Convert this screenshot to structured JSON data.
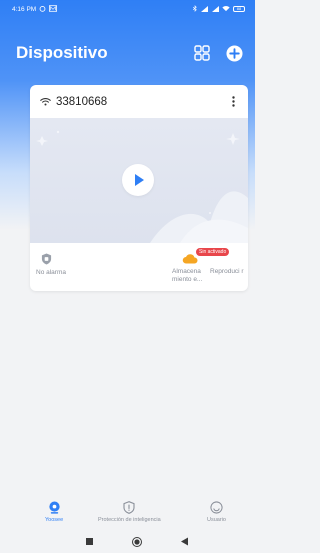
{
  "status_bar": {
    "time": "4:16 PM",
    "battery": "88"
  },
  "header": {
    "title": "Dispositivo"
  },
  "device_card": {
    "name": "33810668",
    "actions": [
      {
        "label": "No alarma"
      },
      {
        "label": "Almacena miento e...",
        "badge": "Sin activado"
      },
      {
        "label": "Reproduci r"
      }
    ]
  },
  "bottom_nav": {
    "items": [
      {
        "label": "Yoosee",
        "active": true
      },
      {
        "label": "Protección de inteligencia",
        "active": false
      },
      {
        "label": "Usuario",
        "active": false
      }
    ]
  },
  "colors": {
    "accent": "#2f7ff5",
    "badge": "#e8464b",
    "cloud": "#f5a623"
  }
}
